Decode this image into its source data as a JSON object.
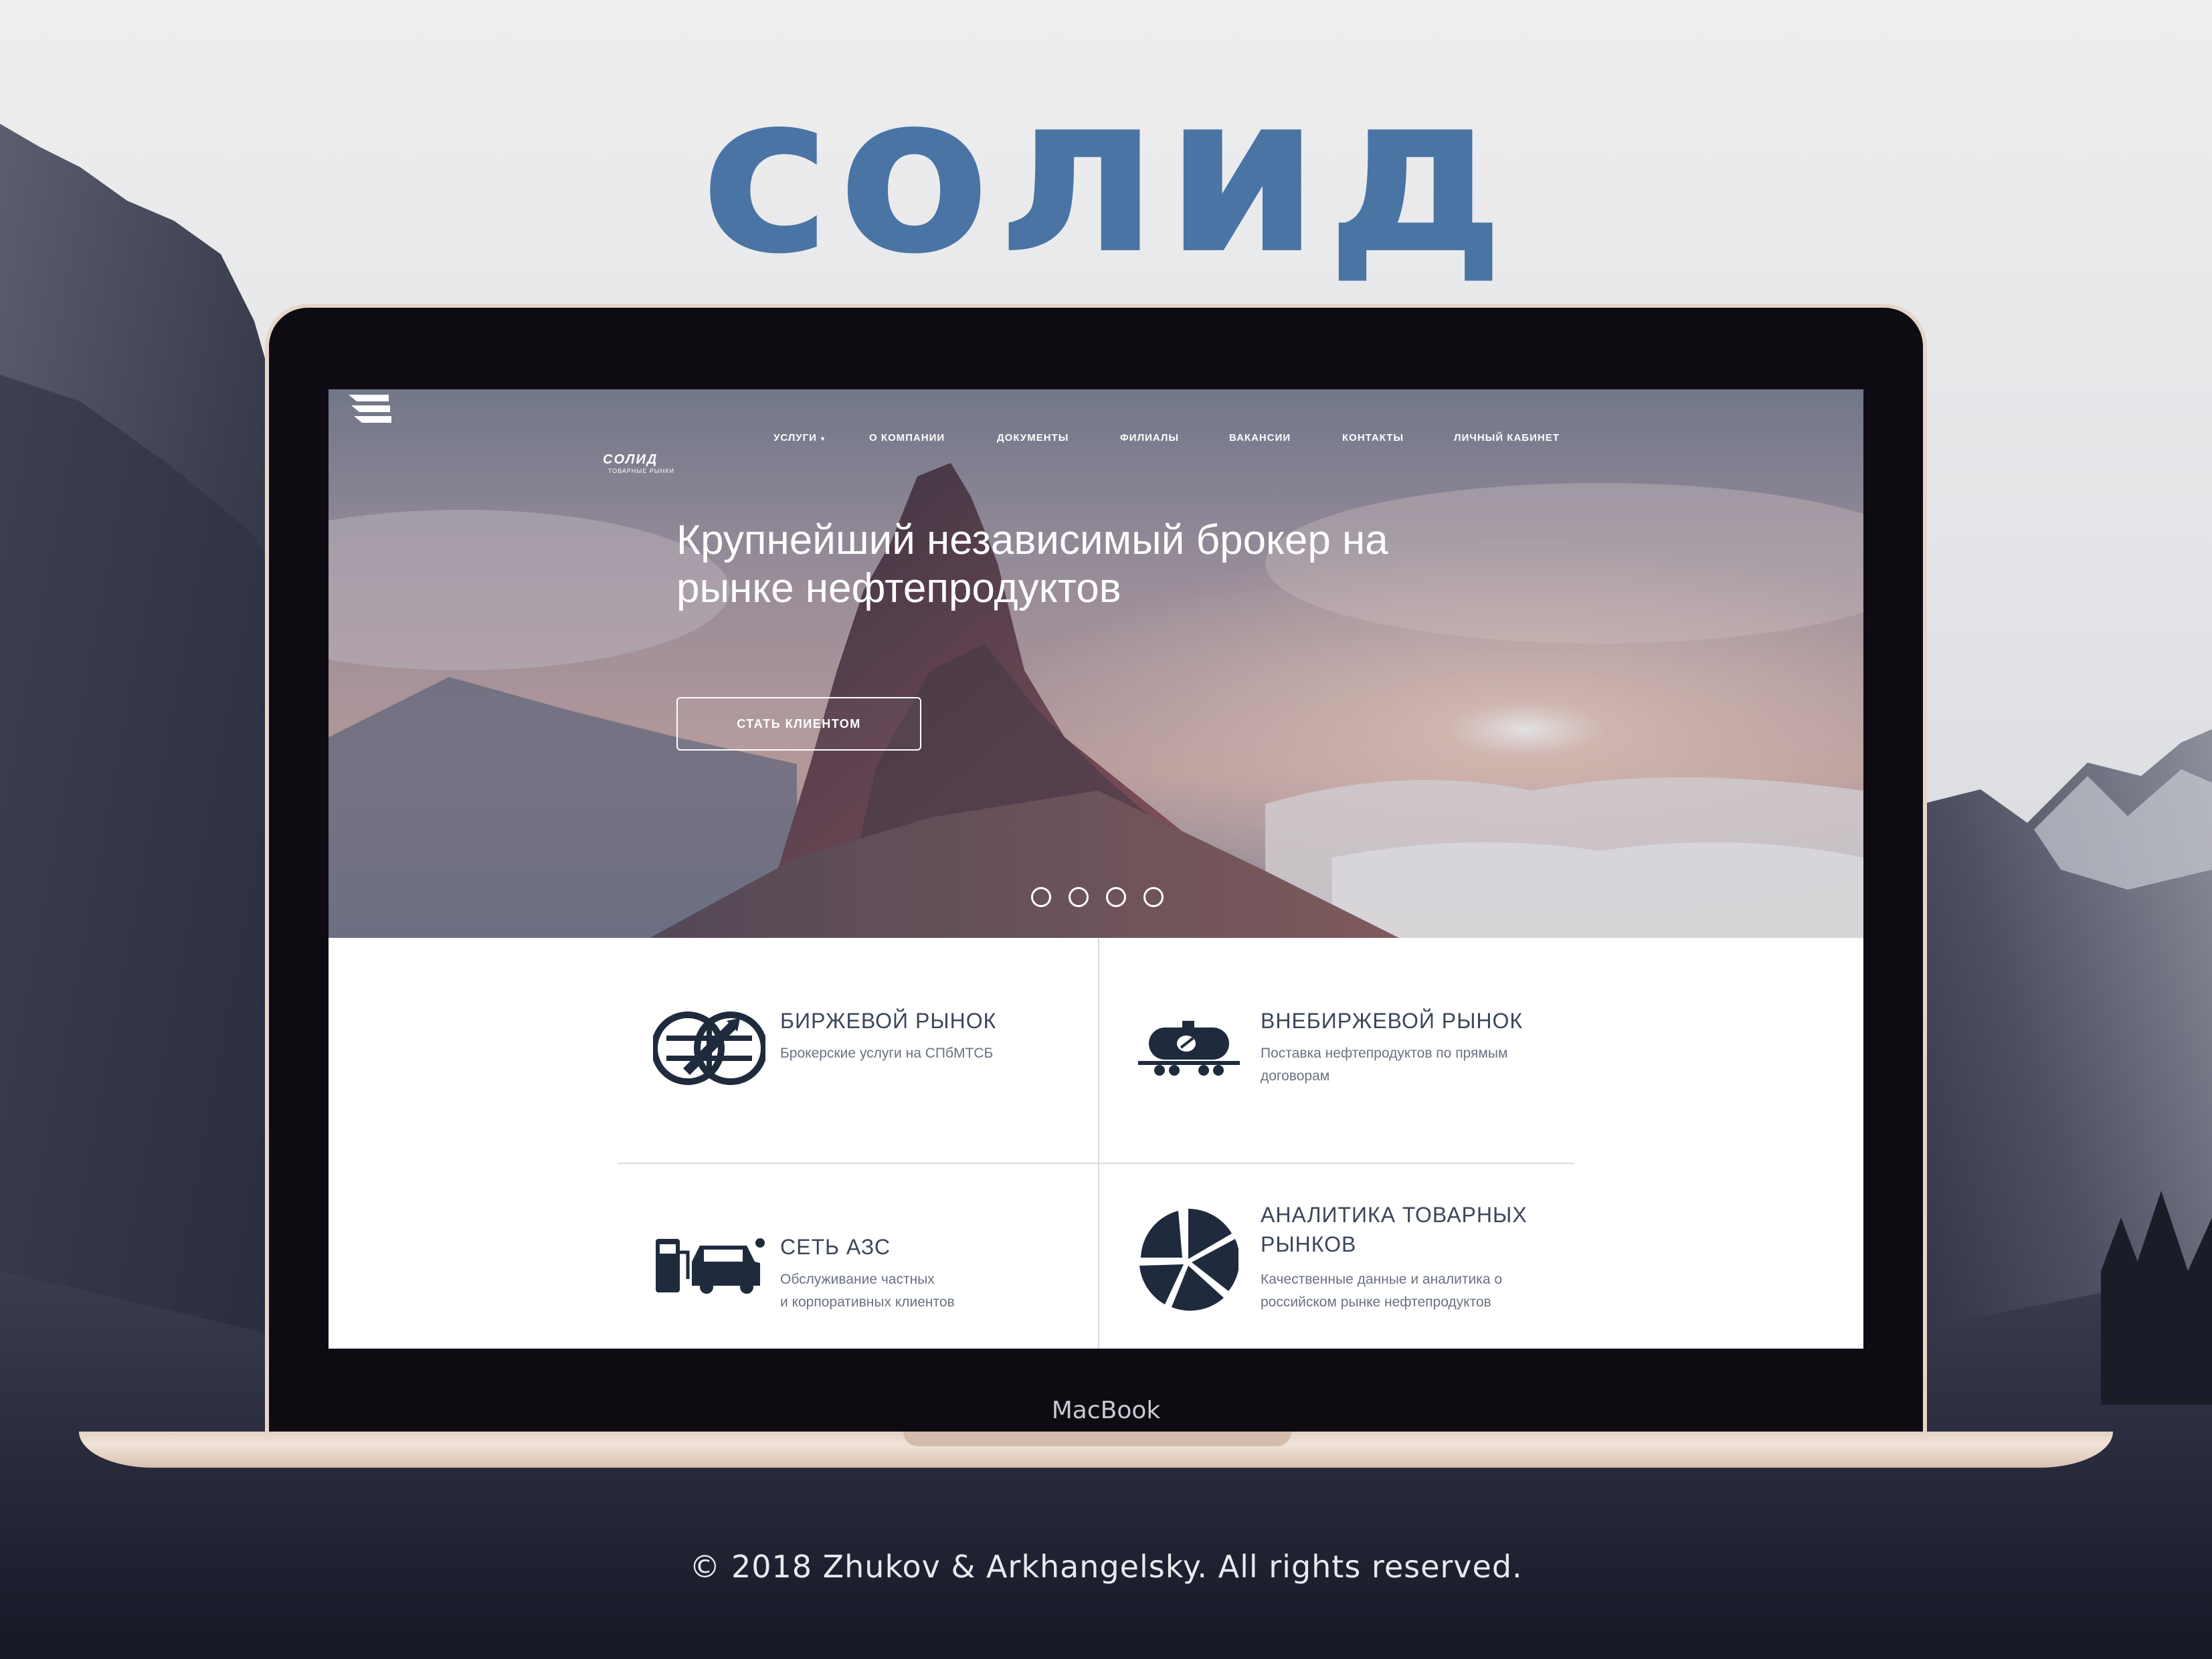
{
  "brand_title": "солид",
  "site": {
    "logo": {
      "name": "СОЛИД",
      "subtitle": "ТОВАРНЫЕ РЫНКИ"
    },
    "nav": [
      {
        "label": "УСЛУГИ",
        "caret": "▾"
      },
      {
        "label": "О КОМПАНИИ"
      },
      {
        "label": "ДОКУМЕНТЫ"
      },
      {
        "label": "ФИЛИАЛЫ"
      },
      {
        "label": "ВАКАНСИИ"
      },
      {
        "label": "КОНТАКТЫ"
      },
      {
        "label": "ЛИЧНЫЙ КАБИНЕТ"
      }
    ],
    "hero": {
      "heading_line1": "Крупнейший независимый брокер на",
      "heading_line2": "рынке нефтепродуктов",
      "cta_label": "СТАТЬ КЛИЕНТОМ",
      "slides_count": 4
    },
    "services": [
      {
        "title": "БИРЖЕВОЙ РЫНОК",
        "description": "Брокерские услуги на СПбМТСБ",
        "icon": "globe-exchange-icon"
      },
      {
        "title": "ВНЕБИРЖЕВОЙ РЫНОК",
        "description": "Поставка нефтепродуктов по прямым\nдоговорам",
        "icon": "tank-car-icon"
      },
      {
        "title": "СЕТЬ АЗС",
        "description": "Обслуживание частных\nи корпоративных клиентов",
        "icon": "gas-station-car-icon"
      },
      {
        "title_line1": "АНАЛИТИКА ТОВАРНЫХ",
        "title_line2": "РЫНКОВ",
        "description": "Качественные данные и аналитика о\nроссийском рынке нефтепродуктов",
        "icon": "pie-analytics-icon"
      }
    ]
  },
  "device_label": "MacBook",
  "copyright": "© 2018 Zhukov & Arkhangelsky. All rights reserved.",
  "colors": {
    "brand_blue": "#4a74a4",
    "icon_navy": "#1f2b3d",
    "text_dark": "#3b4658"
  }
}
